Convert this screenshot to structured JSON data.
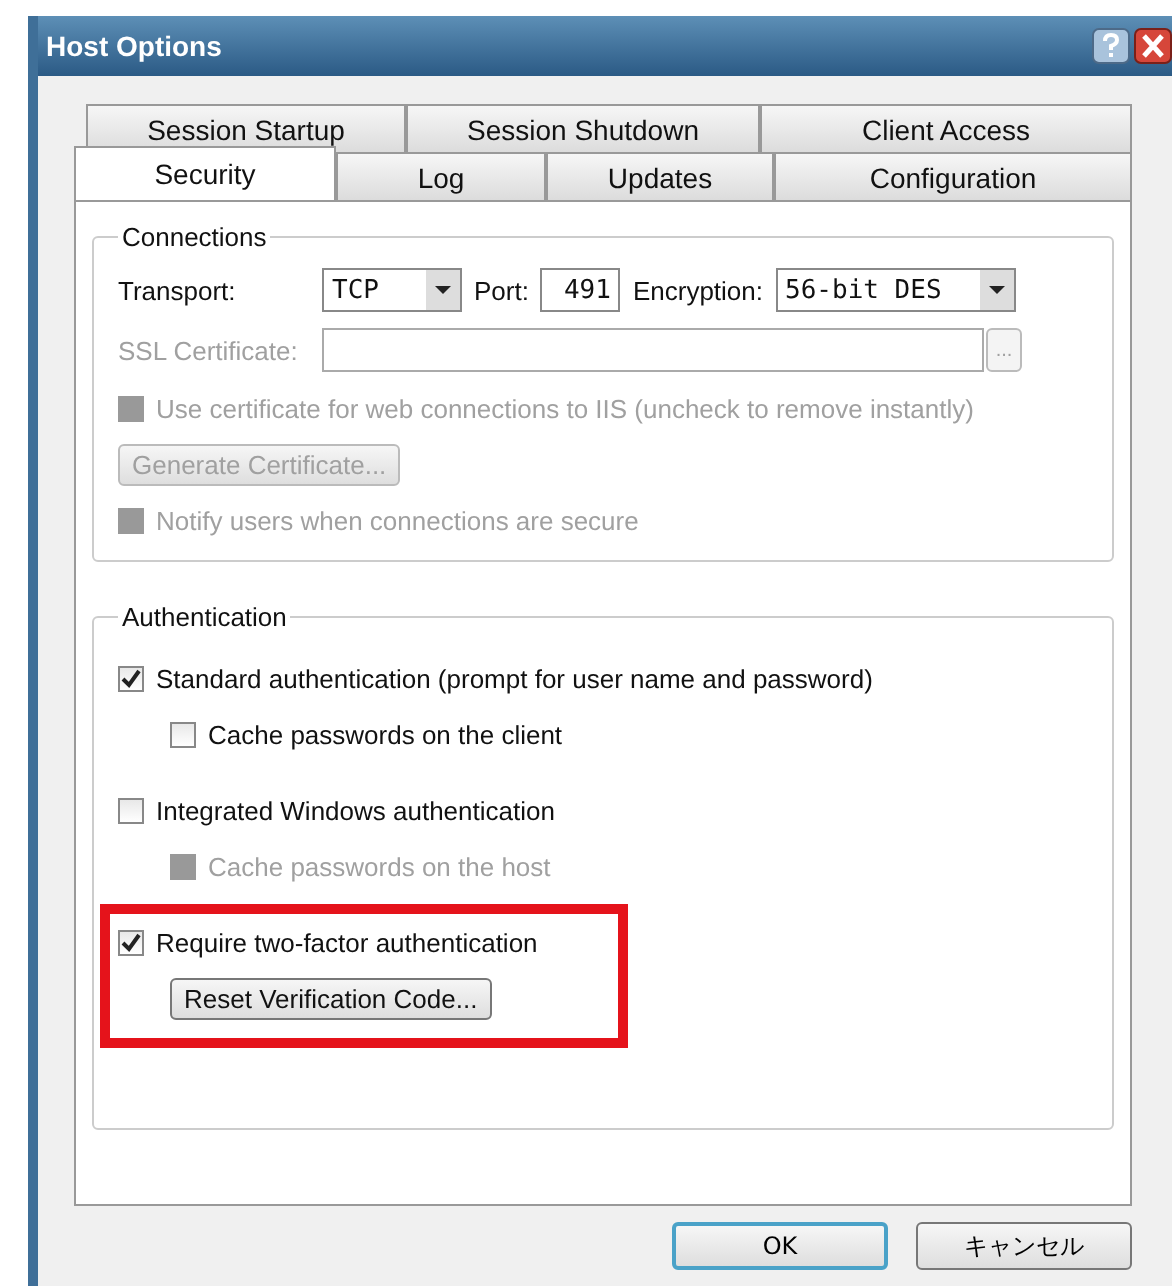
{
  "window": {
    "title": "Host Options"
  },
  "tab_rows": [
    [
      {
        "label": "Session Startup",
        "selected": false
      },
      {
        "label": "Session Shutdown",
        "selected": false
      },
      {
        "label": "Client Access",
        "selected": false
      }
    ],
    [
      {
        "label": "Security",
        "selected": true
      },
      {
        "label": "Log",
        "selected": false
      },
      {
        "label": "Updates",
        "selected": false
      },
      {
        "label": "Configuration",
        "selected": false
      }
    ]
  ],
  "connections": {
    "title": "Connections",
    "transport": {
      "label": "Transport:",
      "value": "TCP"
    },
    "port": {
      "label": "Port:",
      "value": "491"
    },
    "encryption": {
      "label": "Encryption:",
      "value": "56-bit DES"
    },
    "ssl_certificate": {
      "label": "SSL Certificate:",
      "disabled": true,
      "browse": "..."
    },
    "options": [
      {
        "kind": "checkbox",
        "label": "Use certificate for web connections to IIS (uncheck to remove instantly)",
        "checked": false,
        "disabled": true
      },
      {
        "kind": "button",
        "label": "Generate Certificate...",
        "disabled": true
      },
      {
        "kind": "checkbox",
        "label": "Notify users when connections are secure",
        "checked": false,
        "disabled": true
      }
    ]
  },
  "authentication": {
    "title": "Authentication",
    "options": [
      {
        "label": "Standard authentication (prompt for user name and password)",
        "checked": true,
        "disabled": false,
        "highlighted": false,
        "children": [
          {
            "label": "Cache passwords on the client",
            "checked": false,
            "disabled": false
          }
        ]
      },
      {
        "label": "Integrated Windows authentication",
        "checked": false,
        "disabled": false,
        "highlighted": false,
        "children": [
          {
            "label": "Cache passwords on the host",
            "checked": false,
            "disabled": true
          }
        ]
      },
      {
        "label": "Require two-factor authentication",
        "checked": true,
        "disabled": false,
        "highlighted": true,
        "button": "Reset Verification Code..."
      }
    ]
  },
  "buttons": [
    {
      "label": "OK",
      "default": true
    },
    {
      "label": "キャンセル",
      "default": false
    }
  ]
}
